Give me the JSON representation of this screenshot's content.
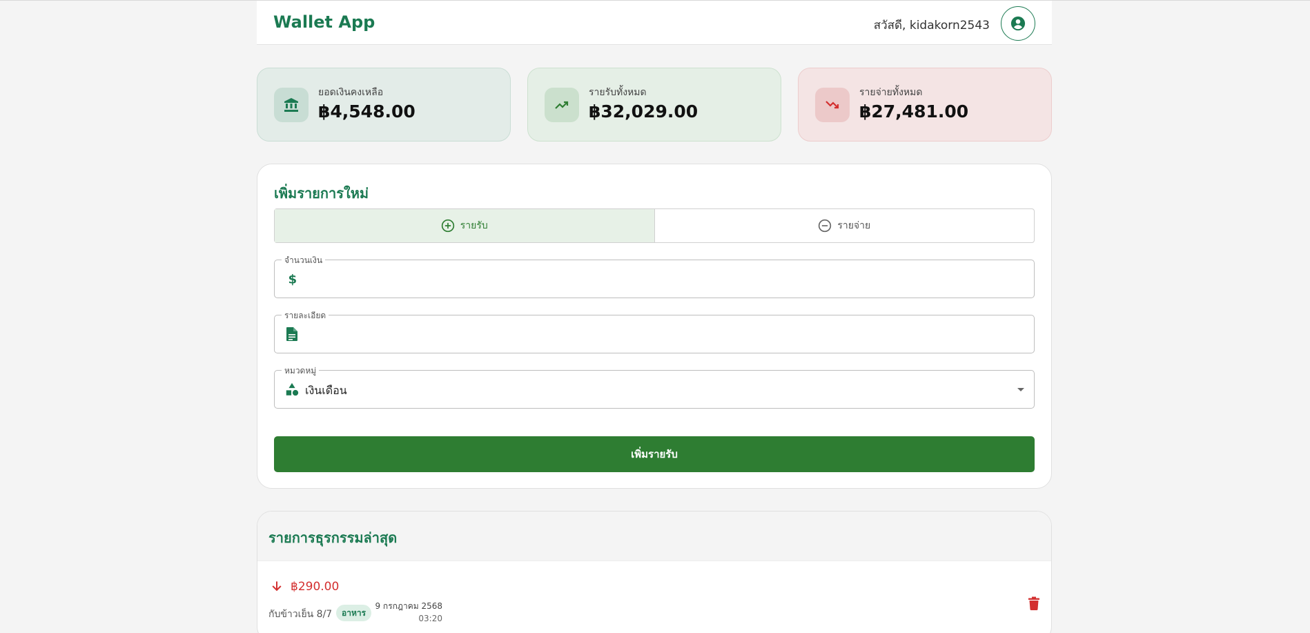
{
  "app": {
    "title": "Wallet App",
    "greeting": "สวัสดี, kidakorn2543",
    "accent": "#1b7a52"
  },
  "summary": {
    "balance": {
      "label": "ยอดเงินคงเหลือ",
      "value": "฿4,548.00",
      "icon": "bank-icon"
    },
    "income": {
      "label": "รายรับทั้งหมด",
      "value": "฿32,029.00",
      "icon": "trending-up-icon"
    },
    "expense": {
      "label": "รายจ่ายทั้งหมด",
      "value": "฿27,481.00",
      "icon": "trending-down-icon"
    }
  },
  "form": {
    "title": "เพิ่มรายการใหม่",
    "toggle": {
      "income_label": "รายรับ",
      "expense_label": "รายจ่าย",
      "selected": "income"
    },
    "amount": {
      "label": "จำนวนเงิน",
      "value": "",
      "icon": "dollar-icon"
    },
    "description": {
      "label": "รายละเอียด",
      "value": "",
      "icon": "document-icon"
    },
    "category": {
      "label": "หมวดหมู่",
      "value": "เงินเดือน",
      "icon": "category-icon"
    },
    "submit_label": "เพิ่มรายรับ",
    "submit_color": "#2e7d32"
  },
  "transactions": {
    "title": "รายการธุรกรรมล่าสุด",
    "items": [
      {
        "type": "expense",
        "amount": "฿290.00",
        "description": "กับข้าวเย็น 8/7",
        "category": "อาหาร",
        "date": "9 กรกฎาคม 2568",
        "time": "03:20",
        "amount_color": "#d32f2f"
      }
    ]
  }
}
